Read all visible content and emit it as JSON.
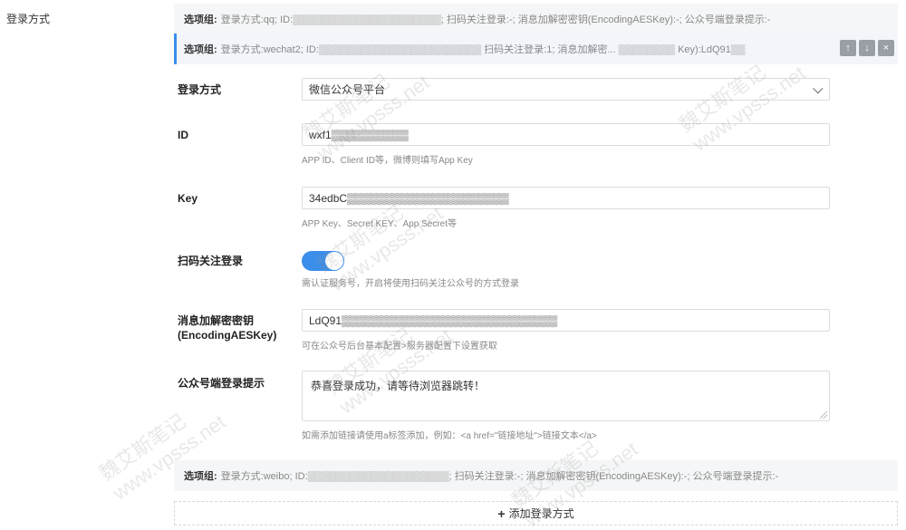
{
  "section": {
    "title": "登录方式"
  },
  "groups": [
    {
      "prefix": "选项组:",
      "summary": "登录方式:qq; ID:▒▒▒▒▒▒▒▒▒▒▒▒▒▒▒▒▒▒▒▒▒; 扫码关注登录:-; 消息加解密密钥(EncodingAESKey):-; 公众号端登录提示:-"
    },
    {
      "prefix": "选项组:",
      "summary": "登录方式:wechat2; ID:▒▒▒▒▒▒▒▒▒▒▒▒▒▒▒▒▒▒▒▒▒▒▒ 扫码关注登录:1; 消息加解密... ▒▒▒▒▒▒▒▒ Key):LdQ91▒▒"
    },
    {
      "prefix": "选项组:",
      "summary": "登录方式:weibo; ID:▒▒▒▒▒▒▒▒▒▒▒▒▒▒▒▒▒▒▒▒; 扫码关注登录:-; 消息加解密密钥(EncodingAESKey):-; 公众号端登录提示:-"
    }
  ],
  "tools": {
    "up": "↑",
    "down": "↓",
    "close": "×"
  },
  "form": {
    "login_method": {
      "label": "登录方式",
      "value": "微信公众号平台"
    },
    "id": {
      "label": "ID",
      "value": "wxf1▒▒▒▒▒▒▒▒▒▒",
      "help": "APP ID、Client ID等，微博则填写App Key"
    },
    "key": {
      "label": "Key",
      "value": "34edbC▒▒▒▒▒▒▒▒▒▒▒▒▒▒▒▒▒▒▒▒▒",
      "help": "APP Key、Secret KEY、App Secret等"
    },
    "scan_follow": {
      "label": "扫码关注登录",
      "enabled": true,
      "help": "需认证服务号，开启将使用扫码关注公众号的方式登录"
    },
    "aes_key": {
      "label_line1": "消息加解密密钥",
      "label_line2": "(EncodingAESKey)",
      "value": "LdQ91▒▒▒▒▒▒▒▒▒▒▒▒▒▒▒▒▒▒▒▒▒▒▒▒▒▒▒▒",
      "help": "可在公众号后台基本配置>服务器配置下设置获取"
    },
    "login_tip": {
      "label": "公众号端登录提示",
      "value": "恭喜登录成功，请等待浏览器跳转！",
      "help": "如需添加链接请使用a标签添加，例如：<a href=\"链接地址\">链接文本</a>"
    }
  },
  "add_button": {
    "icon": "+",
    "label": "添加登录方式"
  },
  "watermark": {
    "name": "魏艾斯笔记",
    "site": "www.vpsss.net"
  },
  "colors": {
    "accent": "#3b8eea",
    "bar_bg": "#f5f6f7"
  }
}
